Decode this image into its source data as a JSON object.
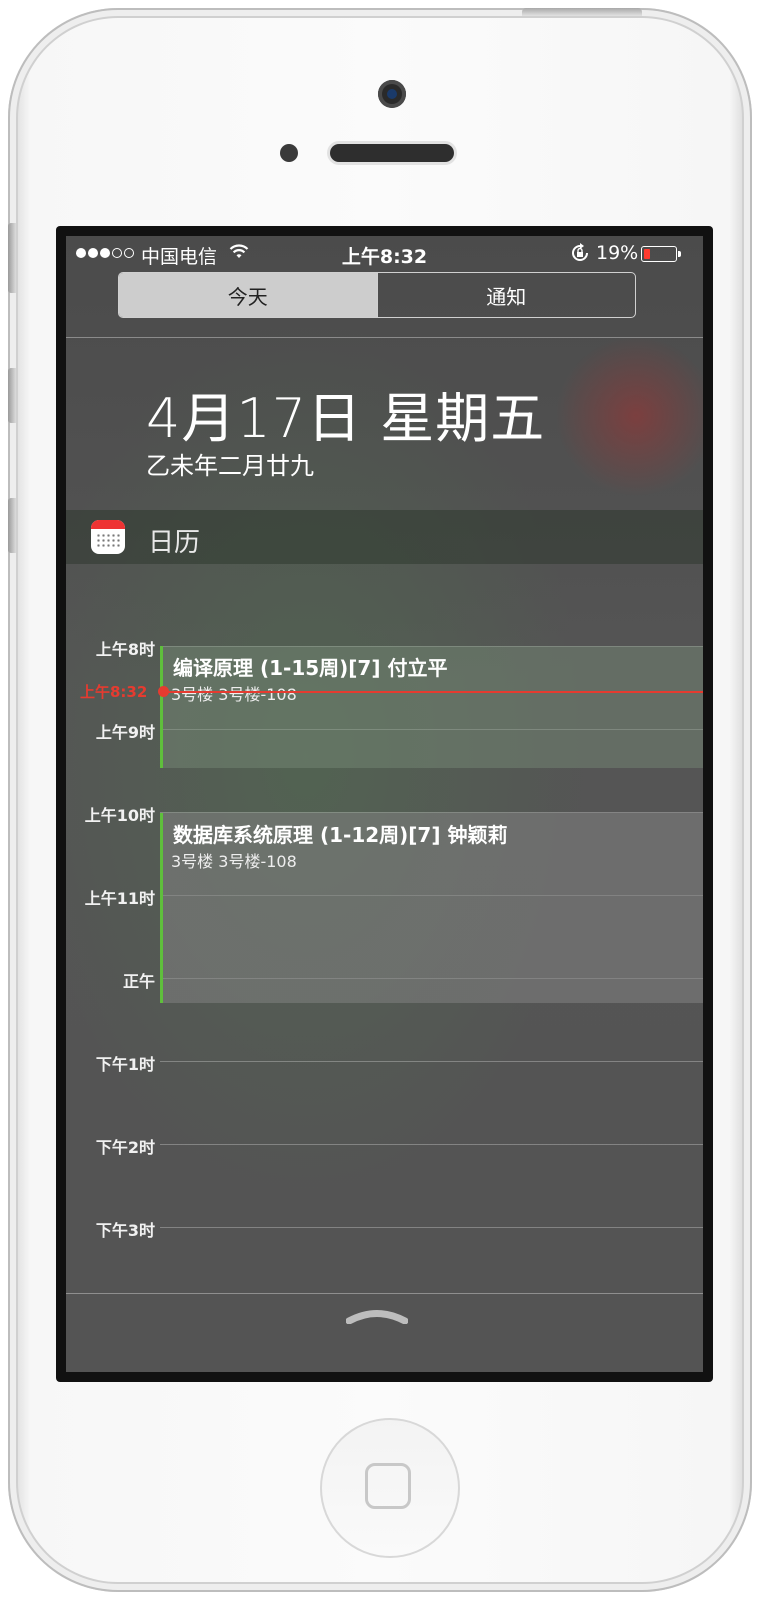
{
  "status_bar": {
    "carrier": "中国电信",
    "time": "上午8:32",
    "battery_percent": "19%",
    "battery_level": 0.19,
    "signal_bars": 3,
    "signal_total": 5
  },
  "tabs": [
    {
      "label": "今天",
      "active": true
    },
    {
      "label": "通知",
      "active": false
    }
  ],
  "header": {
    "date": "4月17日 星期五",
    "lunar_date": "乙未年二月廿九"
  },
  "calendar_widget": {
    "title": "日历",
    "hours": [
      "上午8时",
      "上午9时",
      "上午10时",
      "上午11时",
      "正午",
      "下午1时",
      "下午2时",
      "下午3时"
    ],
    "current_time_label": "上午8:32",
    "events": [
      {
        "title": "编译原理 (1-15周)[7] 付立平",
        "location": "3号楼 3号楼-108"
      },
      {
        "title": "数据库系统原理 (1-12周)[7] 钟颖莉",
        "location": "3号楼 3号楼-108"
      }
    ]
  },
  "colors": {
    "event_bar": "#5fbf3c",
    "now_indicator": "#e53b30",
    "battery_low": "#ff3b30"
  },
  "icons": [
    "wifi-icon",
    "rotation-lock-icon",
    "battery-icon",
    "calendar-app-icon",
    "grabber-icon"
  ]
}
